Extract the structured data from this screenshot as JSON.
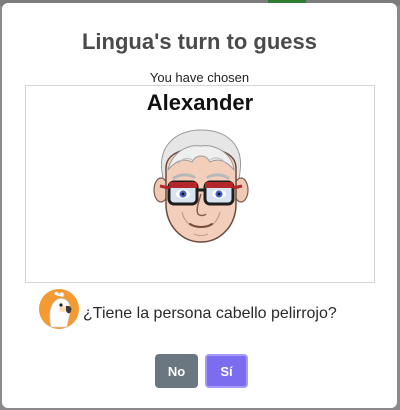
{
  "dialog": {
    "title": "Lingua's turn to guess",
    "chosen_label": "You have chosen",
    "chosen_name": "Alexander",
    "question": "¿Tiene la persona cabello pelirrojo?",
    "buttons": {
      "no": "No",
      "yes": "Sí"
    }
  },
  "icons": {
    "avatar": "cockatoo-avatar-icon",
    "portrait": "elderly-man-with-glasses-portrait"
  },
  "colors": {
    "no_button": "#6b7780",
    "yes_button": "#7b6cf0",
    "avatar_bg": "#f39a33",
    "glasses_frame": "#b3262a"
  }
}
